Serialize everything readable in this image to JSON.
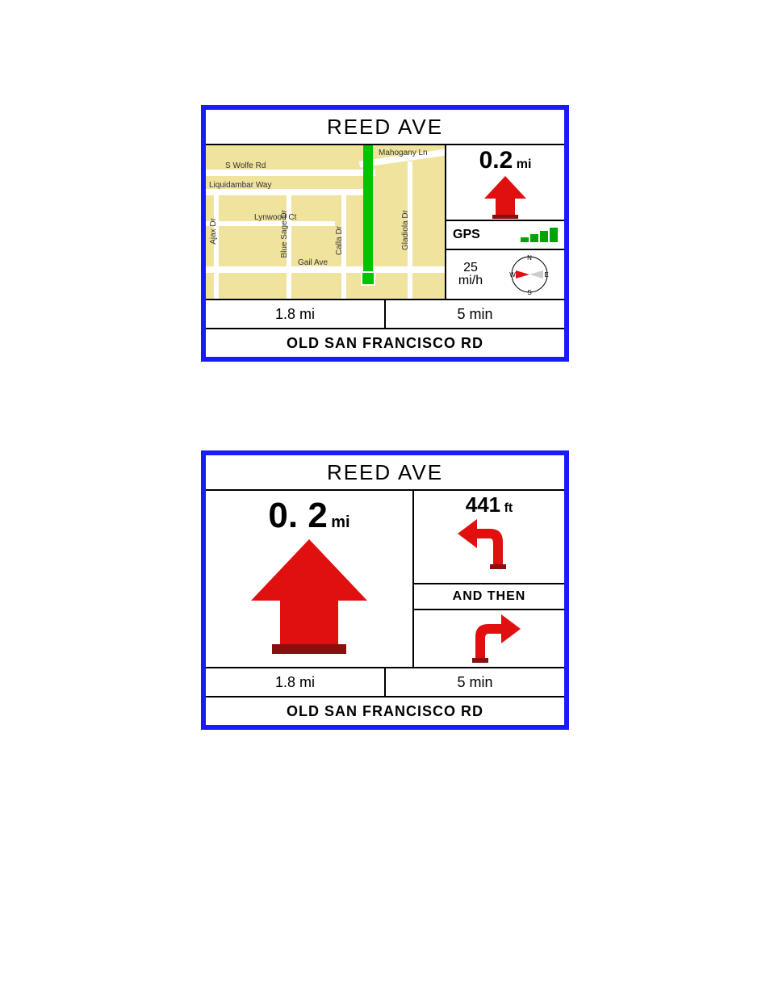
{
  "screen1": {
    "title": "REED AVE",
    "distance": {
      "value": "0.2",
      "unit": "mi"
    },
    "gps": {
      "label": "GPS",
      "bars": 4
    },
    "speed": {
      "value": "25",
      "unit": "mi/h"
    },
    "stats": {
      "total_distance": "1.8 mi",
      "time": "5 min"
    },
    "current_road": "OLD SAN FRANCISCO RD",
    "direction": "straight",
    "map": {
      "roads": [
        "S Wolfe Rd",
        "Liquidambar Way",
        "Lynwood Ct",
        "Gail Ave",
        "Mahogany Ln",
        "Ajax Dr",
        "Blue Sage Dr",
        "Calla Dr",
        "Gladiola Dr"
      ]
    }
  },
  "screen2": {
    "title": "REED AVE",
    "distance": {
      "value": "0. 2",
      "unit": "mi"
    },
    "direction": "straight",
    "next": {
      "value": "441",
      "unit": "ft",
      "turn": "left"
    },
    "then_label": "AND THEN",
    "after": {
      "turn": "right"
    },
    "stats": {
      "total_distance": "1.8 mi",
      "time": "5 min"
    },
    "current_road": "OLD SAN FRANCISCO RD"
  },
  "colors": {
    "border": "#1a1aff",
    "arrow": "#e01010",
    "arrow_shadow": "#8a1010",
    "map_bg": "#efe39e",
    "route": "#00c400",
    "gps": "#00a400"
  }
}
